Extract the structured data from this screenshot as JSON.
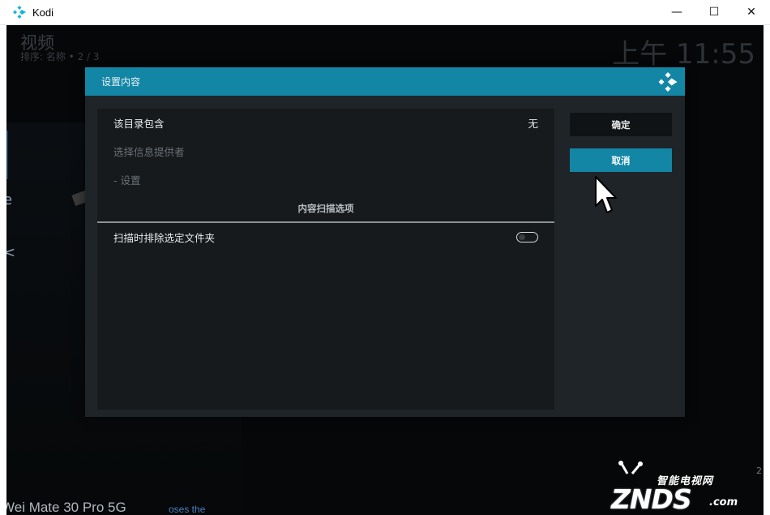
{
  "window": {
    "title": "Kodi",
    "controls": {
      "minimize": "—",
      "maximize": "☐",
      "close": "✕"
    }
  },
  "header": {
    "title": "视频",
    "subtitle": "排序: 名称  •  2 / 3",
    "clock": "上午 11:55"
  },
  "background": {
    "bottom_text": "Wei Mate 30 Pro 5G",
    "bottom_link": "oses the",
    "side_chars": [
      "e",
      "<"
    ],
    "corner_char": "2"
  },
  "dialog": {
    "title": "设置内容",
    "rows": [
      {
        "label": "该目录包含",
        "value": "无",
        "enabled": true
      },
      {
        "label": "选择信息提供者",
        "enabled": false
      },
      {
        "label": "- 设置",
        "enabled": false
      }
    ],
    "section_title": "内容扫描选项",
    "toggle_row": {
      "label": "扫描时排除选定文件夹",
      "on": false
    },
    "buttons": {
      "ok": "确定",
      "cancel": "取消"
    }
  },
  "watermark": {
    "tag": "智能电视网",
    "main": "ZNDS",
    "suffix": ".com"
  },
  "colors": {
    "accent": "#1386a6",
    "dialog_bg": "#1f2428",
    "panel_bg": "#161a1d",
    "app_bg": "#050708"
  },
  "icons": {
    "app": "kodi-logo-icon",
    "cursor": "mouse-pointer-icon"
  }
}
